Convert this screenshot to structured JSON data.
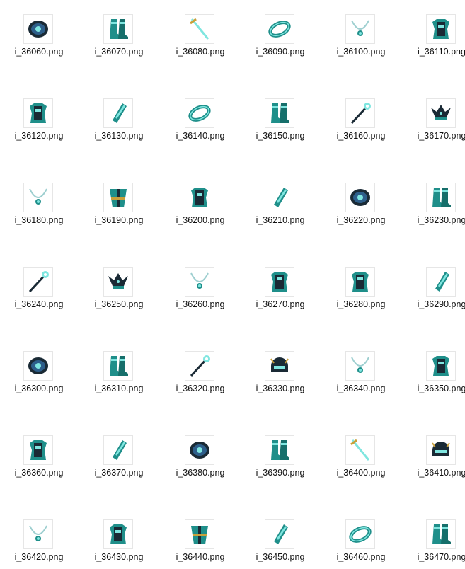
{
  "files": [
    {
      "name": "i_36060.png",
      "icon": "ring-icon"
    },
    {
      "name": "i_36070.png",
      "icon": "boots-icon"
    },
    {
      "name": "i_36080.png",
      "icon": "sword-icon"
    },
    {
      "name": "i_36090.png",
      "icon": "bracelet-icon"
    },
    {
      "name": "i_36100.png",
      "icon": "necklace-icon"
    },
    {
      "name": "i_36110.png",
      "icon": "armor-icon"
    },
    {
      "name": "i_36120.png",
      "icon": "armor-icon"
    },
    {
      "name": "i_36130.png",
      "icon": "bracer-icon"
    },
    {
      "name": "i_36140.png",
      "icon": "bracelet-icon"
    },
    {
      "name": "i_36150.png",
      "icon": "boots-icon"
    },
    {
      "name": "i_36160.png",
      "icon": "staff-icon"
    },
    {
      "name": "i_36170.png",
      "icon": "crown-icon"
    },
    {
      "name": "i_36180.png",
      "icon": "necklace-icon"
    },
    {
      "name": "i_36190.png",
      "icon": "robe-icon"
    },
    {
      "name": "i_36200.png",
      "icon": "armor-icon"
    },
    {
      "name": "i_36210.png",
      "icon": "bracer-icon"
    },
    {
      "name": "i_36220.png",
      "icon": "ring-icon"
    },
    {
      "name": "i_36230.png",
      "icon": "boots-icon"
    },
    {
      "name": "i_36240.png",
      "icon": "staff-icon"
    },
    {
      "name": "i_36250.png",
      "icon": "crown-icon"
    },
    {
      "name": "i_36260.png",
      "icon": "necklace-icon"
    },
    {
      "name": "i_36270.png",
      "icon": "armor-icon"
    },
    {
      "name": "i_36280.png",
      "icon": "armor-icon"
    },
    {
      "name": "i_36290.png",
      "icon": "bracer-icon"
    },
    {
      "name": "i_36300.png",
      "icon": "ring-icon"
    },
    {
      "name": "i_36310.png",
      "icon": "boots-icon"
    },
    {
      "name": "i_36320.png",
      "icon": "staff-icon"
    },
    {
      "name": "i_36330.png",
      "icon": "helmet-icon"
    },
    {
      "name": "i_36340.png",
      "icon": "necklace-icon"
    },
    {
      "name": "i_36350.png",
      "icon": "armor-icon"
    },
    {
      "name": "i_36360.png",
      "icon": "armor-icon"
    },
    {
      "name": "i_36370.png",
      "icon": "bracer-icon"
    },
    {
      "name": "i_36380.png",
      "icon": "ring-icon"
    },
    {
      "name": "i_36390.png",
      "icon": "boots-icon"
    },
    {
      "name": "i_36400.png",
      "icon": "sword-icon"
    },
    {
      "name": "i_36410.png",
      "icon": "helmet-icon"
    },
    {
      "name": "i_36420.png",
      "icon": "necklace-icon"
    },
    {
      "name": "i_36430.png",
      "icon": "armor-icon"
    },
    {
      "name": "i_36440.png",
      "icon": "robe-icon"
    },
    {
      "name": "i_36450.png",
      "icon": "bracer-icon"
    },
    {
      "name": "i_36460.png",
      "icon": "bracelet-icon"
    },
    {
      "name": "i_36470.png",
      "icon": "boots-icon"
    }
  ],
  "colors": {
    "teal": "#1f8f8a",
    "dark": "#1a2a35",
    "glow": "#7fe6e0",
    "gold": "#c9a03a"
  }
}
